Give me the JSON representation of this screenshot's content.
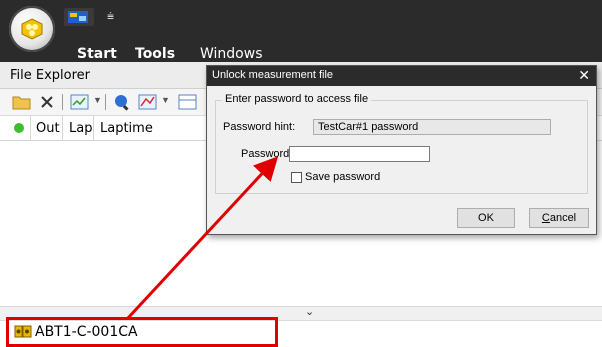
{
  "menu": {
    "start": "Start",
    "tools": "Tools",
    "windows": "Windows",
    "qat_dropdown_glyph": "⩧"
  },
  "explorer": {
    "title": "File Explorer",
    "columns": [
      "Out",
      "Lap",
      "Laptime"
    ],
    "file_name": "ABT1-C-001CA"
  },
  "dialog": {
    "title": "Unlock measurement file",
    "close_glyph": "✕",
    "group_title": "Enter password to access file",
    "hint_label": "Password hint:",
    "hint_value": "TestCar#1 password",
    "password_label": "Password:",
    "password_value": "",
    "save_label": "Save password",
    "ok_label": "OK",
    "cancel_label": "Cancel"
  },
  "colors": {
    "accent_annotation": "#e00000",
    "status_green": "#3bbf2e",
    "header_dark": "#2b2b2b"
  }
}
